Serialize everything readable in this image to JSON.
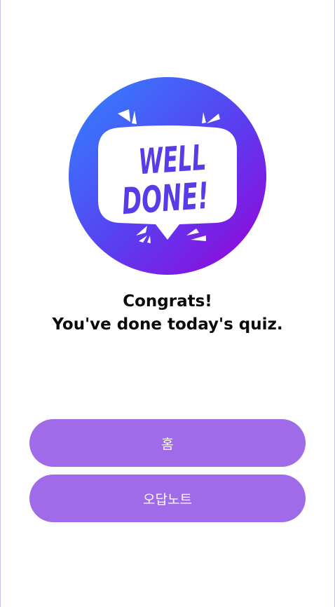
{
  "badge": {
    "line1": "WELL",
    "line2": "DONE!",
    "gradient_start": "#3a7cff",
    "gradient_end": "#9a00d8",
    "text_color": "#5a3be8"
  },
  "message": {
    "line1": "Congrats!",
    "line2": "You've done today's quiz."
  },
  "buttons": {
    "home_label": "홈",
    "wrong_notes_label": "오답노트",
    "color": "#a06be8"
  }
}
